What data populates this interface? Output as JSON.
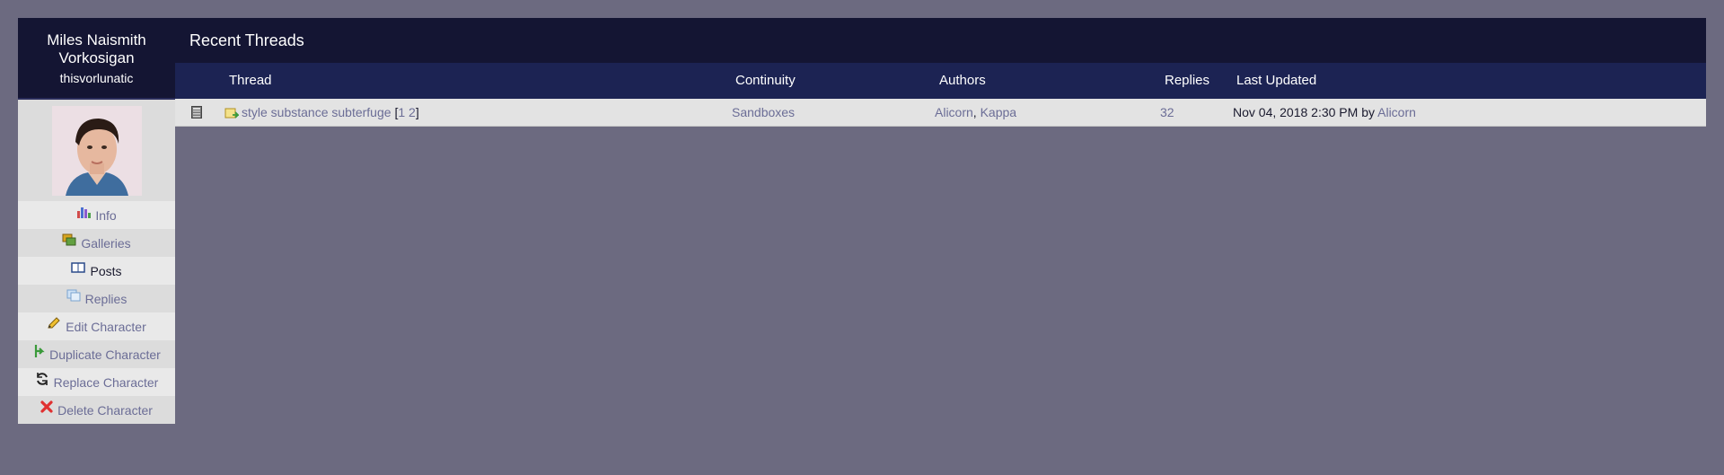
{
  "character": {
    "name_line1": "Miles Naismith",
    "name_line2": "Vorkosigan",
    "username": "thisvorlunatic"
  },
  "menu": [
    {
      "label": "Info",
      "icon": "chart-icon"
    },
    {
      "label": "Galleries",
      "icon": "galleries-icon"
    },
    {
      "label": "Posts",
      "icon": "book-icon"
    },
    {
      "label": "Replies",
      "icon": "replies-icon"
    },
    {
      "label": "Edit Character",
      "icon": "pencil-icon"
    },
    {
      "label": "Duplicate Character",
      "icon": "duplicate-icon"
    },
    {
      "label": "Replace Character",
      "icon": "refresh-icon"
    },
    {
      "label": "Delete Character",
      "icon": "delete-icon"
    }
  ],
  "main": {
    "title": "Recent Threads",
    "columns": {
      "thread": "Thread",
      "continuity": "Continuity",
      "authors": "Authors",
      "replies": "Replies",
      "last_updated": "Last Updated"
    },
    "rows": [
      {
        "thread": "style substance subterfuge",
        "page_open": "[",
        "page1": "1",
        "page2": "2",
        "page_close": "]",
        "continuity": "Sandboxes",
        "author1": "Alicorn",
        "author_sep": ",",
        "author2": "Kappa",
        "replies": "32",
        "last_updated": "Nov 04, 2018 2:30 PM",
        "by": "by",
        "last_author": "Alicorn"
      }
    ]
  },
  "colors": {
    "background": "#6c6a80",
    "header_dark": "#141533",
    "header_blue": "#1c2353",
    "link": "#6b6d96"
  }
}
